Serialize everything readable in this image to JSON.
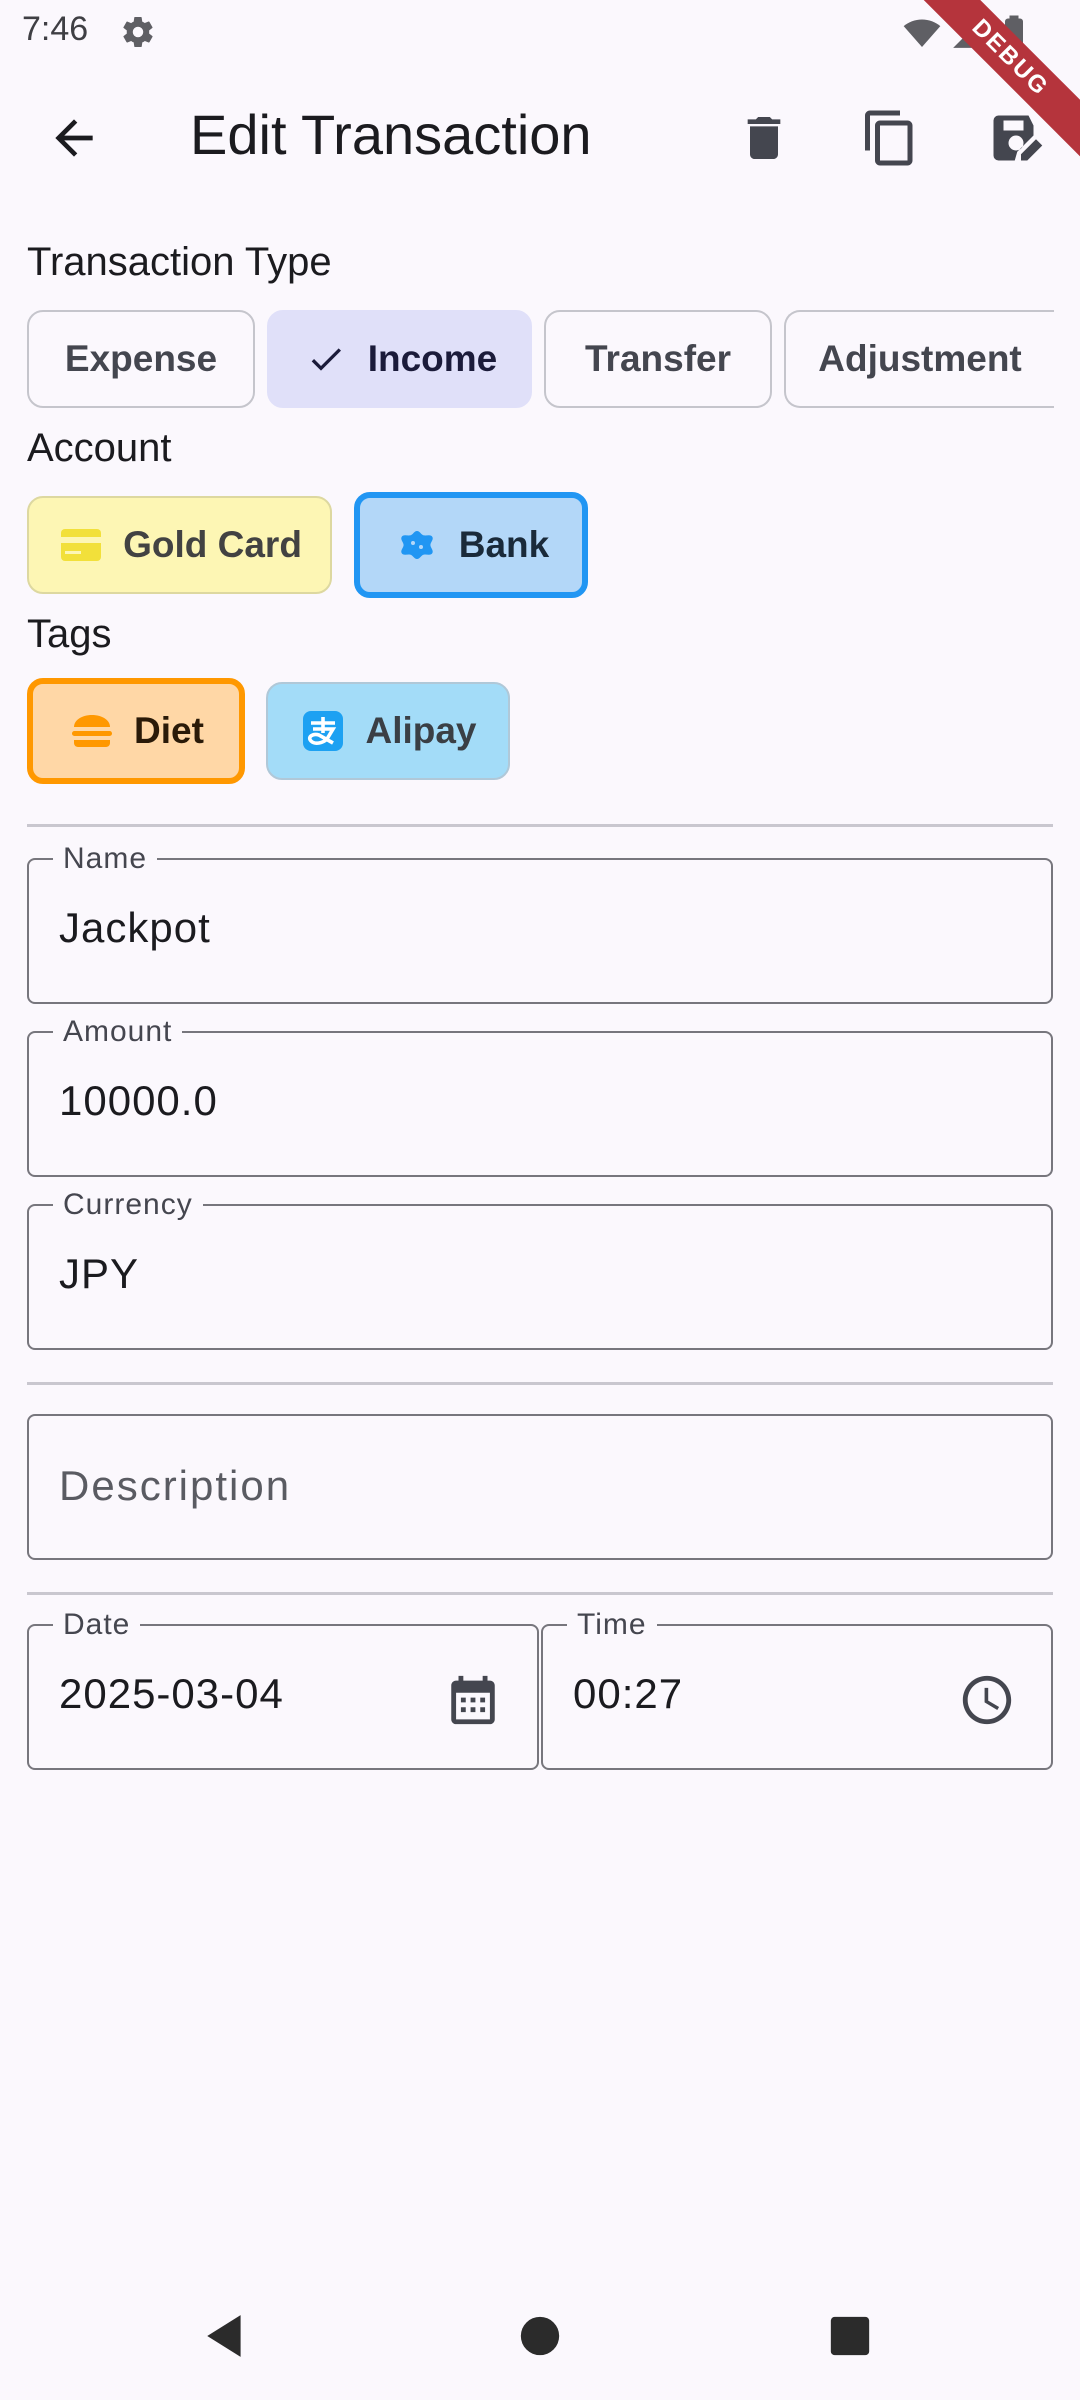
{
  "status_bar": {
    "time": "7:46",
    "debug_label": "DEBUG"
  },
  "app_bar": {
    "title": "Edit Transaction",
    "icons": {
      "back": "arrow-back-icon",
      "delete": "delete-icon",
      "copy": "copy-icon",
      "save": "save-edit-icon"
    }
  },
  "transaction_type": {
    "label": "Transaction Type",
    "options": [
      "Expense",
      "Income",
      "Transfer",
      "Adjustment"
    ],
    "selected": "Income"
  },
  "account": {
    "label": "Account",
    "options": [
      {
        "label": "Gold Card",
        "icon": "credit-card-icon",
        "color": "#fdf6b4"
      },
      {
        "label": "Bank",
        "icon": "bank-icon",
        "color": "#2196f3",
        "selected": true
      }
    ]
  },
  "tags": {
    "label": "Tags",
    "options": [
      {
        "label": "Diet",
        "icon": "burger-icon",
        "color": "#ff9800",
        "selected": true
      },
      {
        "label": "Alipay",
        "icon": "alipay-icon",
        "color": "#a3dcf8"
      }
    ]
  },
  "form": {
    "name": {
      "label": "Name",
      "value": "Jackpot"
    },
    "amount": {
      "label": "Amount",
      "value": "10000.0"
    },
    "currency": {
      "label": "Currency",
      "value": "JPY"
    },
    "description": {
      "placeholder": "Description"
    },
    "date": {
      "label": "Date",
      "value": "2025-03-04",
      "icon": "calendar-icon"
    },
    "time": {
      "label": "Time",
      "value": "00:27",
      "icon": "clock-icon"
    }
  },
  "nav_bar": {
    "icons": [
      "back-triangle-icon",
      "home-circle-icon",
      "recents-square-icon"
    ]
  }
}
